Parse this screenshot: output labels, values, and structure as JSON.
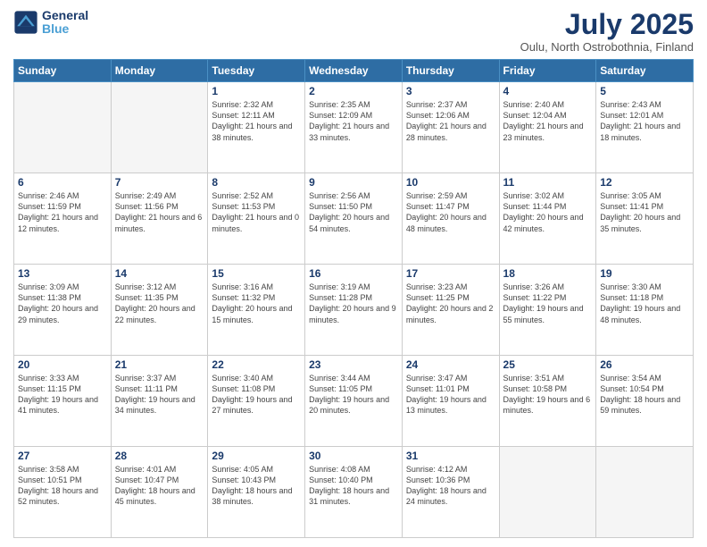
{
  "logo": {
    "line1": "General",
    "line2": "Blue"
  },
  "title": "July 2025",
  "subtitle": "Oulu, North Ostrobothnia, Finland",
  "days_of_week": [
    "Sunday",
    "Monday",
    "Tuesday",
    "Wednesday",
    "Thursday",
    "Friday",
    "Saturday"
  ],
  "weeks": [
    [
      {
        "day": "",
        "info": ""
      },
      {
        "day": "",
        "info": ""
      },
      {
        "day": "1",
        "info": "Sunrise: 2:32 AM\nSunset: 12:11 AM\nDaylight: 21 hours and 38 minutes."
      },
      {
        "day": "2",
        "info": "Sunrise: 2:35 AM\nSunset: 12:09 AM\nDaylight: 21 hours and 33 minutes."
      },
      {
        "day": "3",
        "info": "Sunrise: 2:37 AM\nSunset: 12:06 AM\nDaylight: 21 hours and 28 minutes."
      },
      {
        "day": "4",
        "info": "Sunrise: 2:40 AM\nSunset: 12:04 AM\nDaylight: 21 hours and 23 minutes."
      },
      {
        "day": "5",
        "info": "Sunrise: 2:43 AM\nSunset: 12:01 AM\nDaylight: 21 hours and 18 minutes."
      }
    ],
    [
      {
        "day": "6",
        "info": "Sunrise: 2:46 AM\nSunset: 11:59 PM\nDaylight: 21 hours and 12 minutes."
      },
      {
        "day": "7",
        "info": "Sunrise: 2:49 AM\nSunset: 11:56 PM\nDaylight: 21 hours and 6 minutes."
      },
      {
        "day": "8",
        "info": "Sunrise: 2:52 AM\nSunset: 11:53 PM\nDaylight: 21 hours and 0 minutes."
      },
      {
        "day": "9",
        "info": "Sunrise: 2:56 AM\nSunset: 11:50 PM\nDaylight: 20 hours and 54 minutes."
      },
      {
        "day": "10",
        "info": "Sunrise: 2:59 AM\nSunset: 11:47 PM\nDaylight: 20 hours and 48 minutes."
      },
      {
        "day": "11",
        "info": "Sunrise: 3:02 AM\nSunset: 11:44 PM\nDaylight: 20 hours and 42 minutes."
      },
      {
        "day": "12",
        "info": "Sunrise: 3:05 AM\nSunset: 11:41 PM\nDaylight: 20 hours and 35 minutes."
      }
    ],
    [
      {
        "day": "13",
        "info": "Sunrise: 3:09 AM\nSunset: 11:38 PM\nDaylight: 20 hours and 29 minutes."
      },
      {
        "day": "14",
        "info": "Sunrise: 3:12 AM\nSunset: 11:35 PM\nDaylight: 20 hours and 22 minutes."
      },
      {
        "day": "15",
        "info": "Sunrise: 3:16 AM\nSunset: 11:32 PM\nDaylight: 20 hours and 15 minutes."
      },
      {
        "day": "16",
        "info": "Sunrise: 3:19 AM\nSunset: 11:28 PM\nDaylight: 20 hours and 9 minutes."
      },
      {
        "day": "17",
        "info": "Sunrise: 3:23 AM\nSunset: 11:25 PM\nDaylight: 20 hours and 2 minutes."
      },
      {
        "day": "18",
        "info": "Sunrise: 3:26 AM\nSunset: 11:22 PM\nDaylight: 19 hours and 55 minutes."
      },
      {
        "day": "19",
        "info": "Sunrise: 3:30 AM\nSunset: 11:18 PM\nDaylight: 19 hours and 48 minutes."
      }
    ],
    [
      {
        "day": "20",
        "info": "Sunrise: 3:33 AM\nSunset: 11:15 PM\nDaylight: 19 hours and 41 minutes."
      },
      {
        "day": "21",
        "info": "Sunrise: 3:37 AM\nSunset: 11:11 PM\nDaylight: 19 hours and 34 minutes."
      },
      {
        "day": "22",
        "info": "Sunrise: 3:40 AM\nSunset: 11:08 PM\nDaylight: 19 hours and 27 minutes."
      },
      {
        "day": "23",
        "info": "Sunrise: 3:44 AM\nSunset: 11:05 PM\nDaylight: 19 hours and 20 minutes."
      },
      {
        "day": "24",
        "info": "Sunrise: 3:47 AM\nSunset: 11:01 PM\nDaylight: 19 hours and 13 minutes."
      },
      {
        "day": "25",
        "info": "Sunrise: 3:51 AM\nSunset: 10:58 PM\nDaylight: 19 hours and 6 minutes."
      },
      {
        "day": "26",
        "info": "Sunrise: 3:54 AM\nSunset: 10:54 PM\nDaylight: 18 hours and 59 minutes."
      }
    ],
    [
      {
        "day": "27",
        "info": "Sunrise: 3:58 AM\nSunset: 10:51 PM\nDaylight: 18 hours and 52 minutes."
      },
      {
        "day": "28",
        "info": "Sunrise: 4:01 AM\nSunset: 10:47 PM\nDaylight: 18 hours and 45 minutes."
      },
      {
        "day": "29",
        "info": "Sunrise: 4:05 AM\nSunset: 10:43 PM\nDaylight: 18 hours and 38 minutes."
      },
      {
        "day": "30",
        "info": "Sunrise: 4:08 AM\nSunset: 10:40 PM\nDaylight: 18 hours and 31 minutes."
      },
      {
        "day": "31",
        "info": "Sunrise: 4:12 AM\nSunset: 10:36 PM\nDaylight: 18 hours and 24 minutes."
      },
      {
        "day": "",
        "info": ""
      },
      {
        "day": "",
        "info": ""
      }
    ]
  ]
}
